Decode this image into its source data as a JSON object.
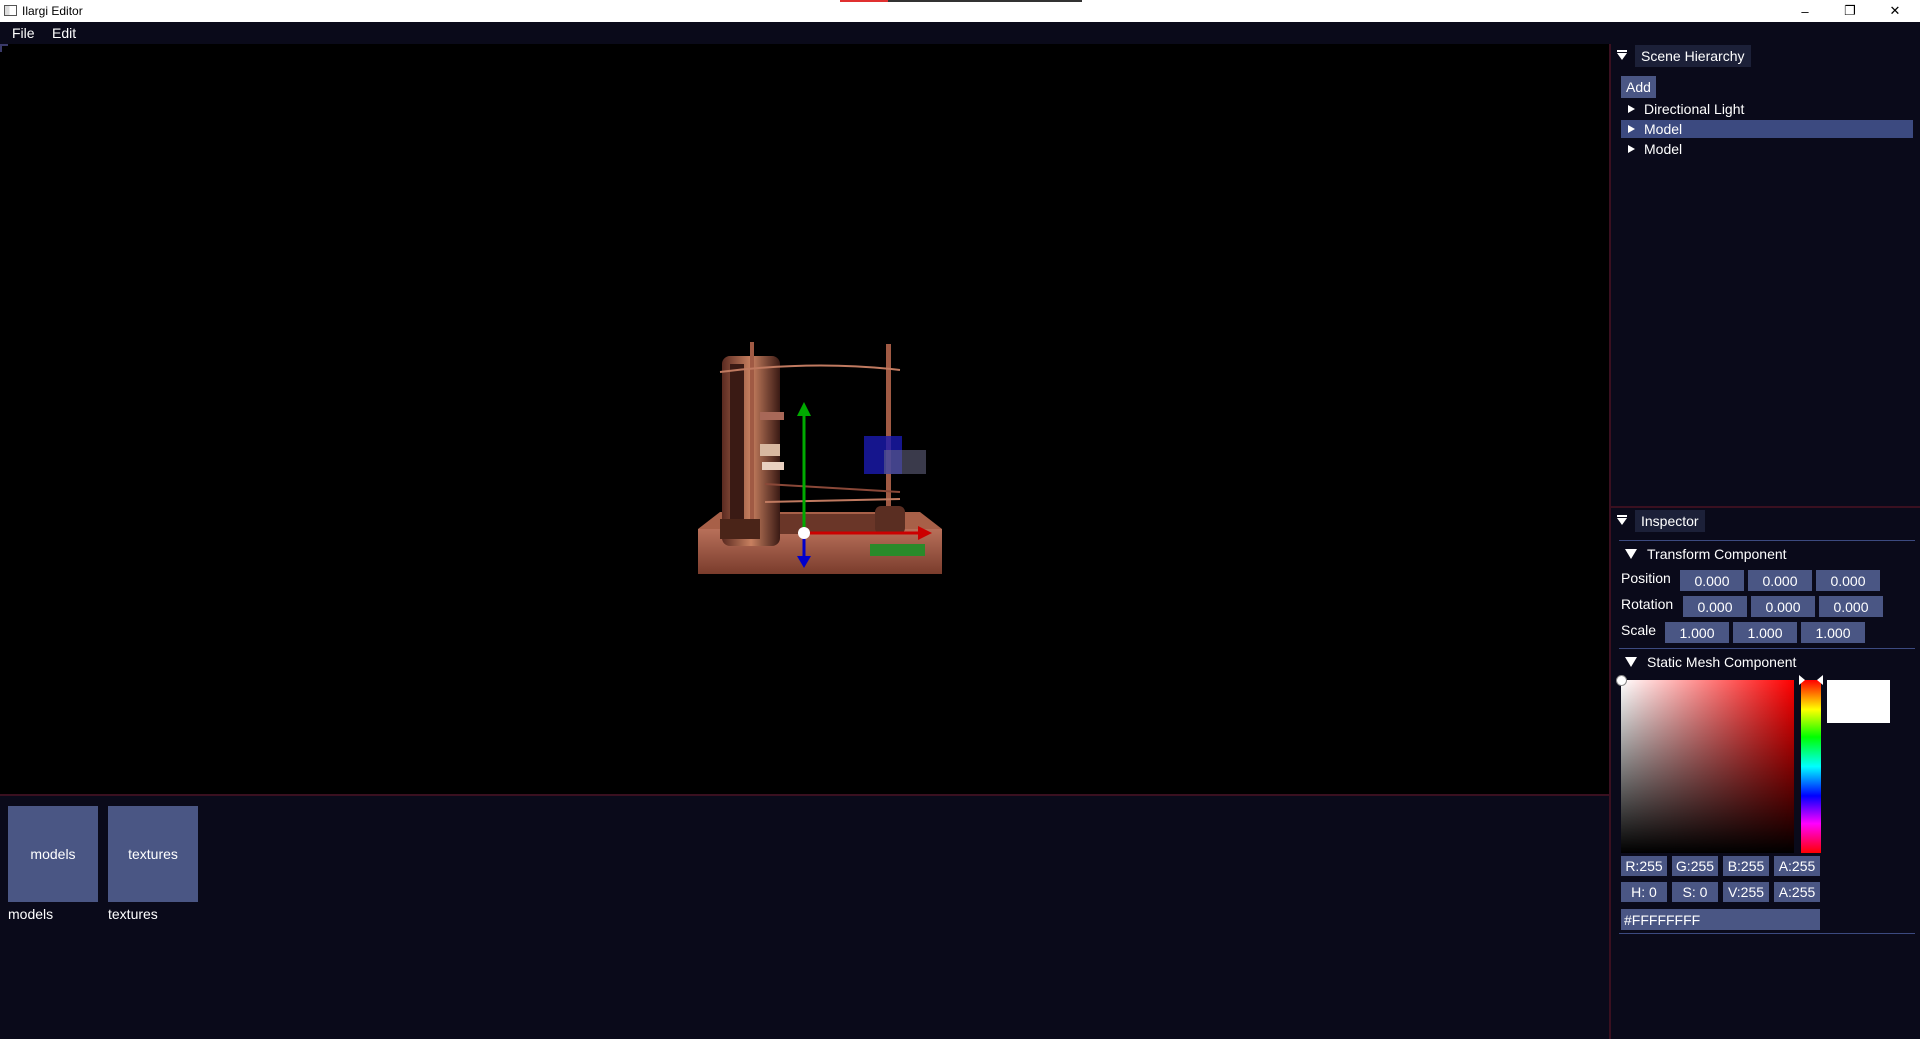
{
  "window": {
    "title": "Ilargi Editor",
    "minimize_glyph": "–",
    "maximize_glyph": "❐",
    "close_glyph": "✕"
  },
  "menubar": {
    "items": [
      {
        "label": "File"
      },
      {
        "label": "Edit"
      }
    ]
  },
  "asset_browser": {
    "folders": [
      {
        "tile_label": "models",
        "name": "models"
      },
      {
        "tile_label": "textures",
        "name": "textures"
      }
    ]
  },
  "scene_hierarchy": {
    "title": "Scene Hierarchy",
    "add_label": "Add",
    "items": [
      {
        "label": "Directional Light",
        "selected": false
      },
      {
        "label": "Model",
        "selected": true
      },
      {
        "label": "Model",
        "selected": false
      }
    ]
  },
  "inspector": {
    "title": "Inspector",
    "transform": {
      "title": "Transform Component",
      "position": {
        "label": "Position",
        "values": [
          "0.000",
          "0.000",
          "0.000"
        ]
      },
      "rotation": {
        "label": "Rotation",
        "values": [
          "0.000",
          "0.000",
          "0.000"
        ]
      },
      "scale": {
        "label": "Scale",
        "values": [
          "1.000",
          "1.000",
          "1.000"
        ]
      }
    },
    "static_mesh": {
      "title": "Static Mesh Component",
      "color_hex": "#FFFFFFFF",
      "rgba": [
        "R:255",
        "G:255",
        "B:255",
        "A:255"
      ],
      "hsva": [
        "H:  0",
        "S:  0",
        "V:255",
        "A:255"
      ]
    }
  },
  "colors": {
    "background": "#0a0a1a",
    "button": "#4a5684",
    "selection": "#3c4a80",
    "separator": "#3a1020",
    "gizmo_x": "#cc0000",
    "gizmo_y": "#00aa00",
    "gizmo_z": "#0000cc"
  },
  "icons": [
    "app-icon",
    "minimize-icon",
    "maximize-icon",
    "close-icon",
    "collapse-arrow-icon",
    "tree-expand-arrow-icon",
    "folder-tile-icon"
  ]
}
